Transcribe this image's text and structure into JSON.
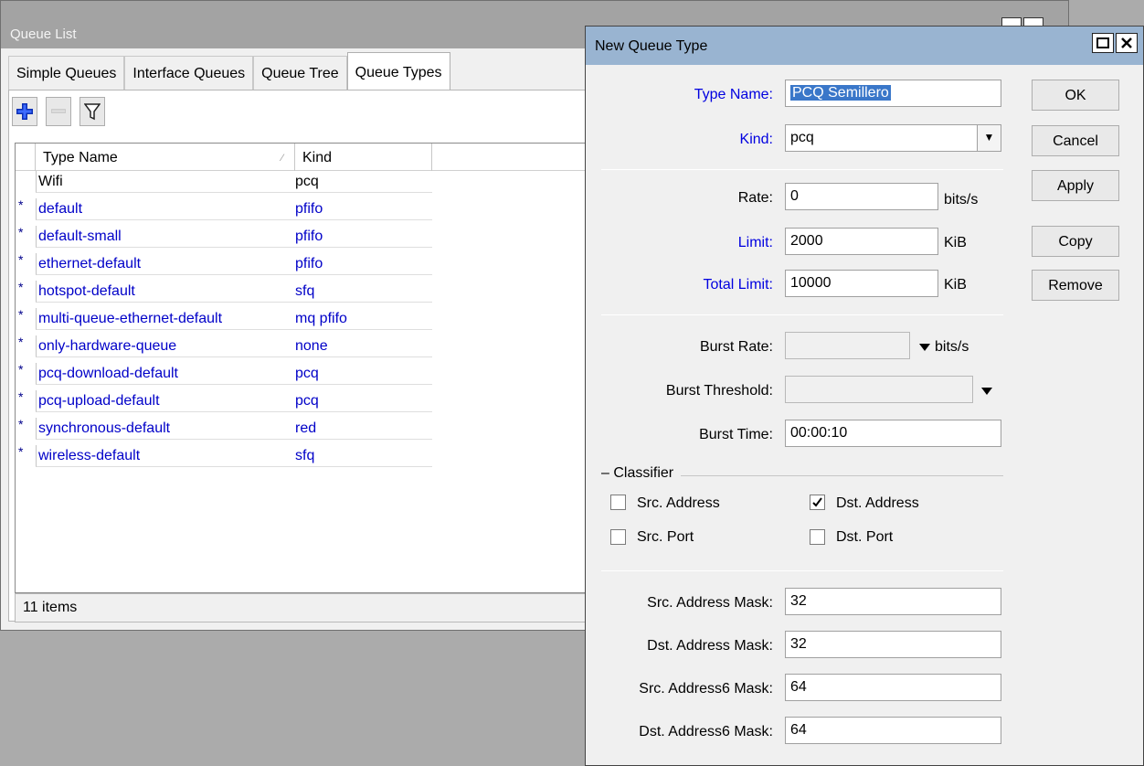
{
  "queue_list": {
    "title": "Queue List",
    "tabs": [
      "Simple Queues",
      "Interface Queues",
      "Queue Tree",
      "Queue Types"
    ],
    "active_tab": "Queue Types",
    "columns": [
      "Type Name",
      "Kind"
    ],
    "rows": [
      {
        "marker": "",
        "name": "Wifi",
        "kind": "pcq"
      },
      {
        "marker": "*",
        "name": "default",
        "kind": "pfifo"
      },
      {
        "marker": "*",
        "name": "default-small",
        "kind": "pfifo"
      },
      {
        "marker": "*",
        "name": "ethernet-default",
        "kind": "pfifo"
      },
      {
        "marker": "*",
        "name": "hotspot-default",
        "kind": "sfq"
      },
      {
        "marker": "*",
        "name": "multi-queue-ethernet-default",
        "kind": "mq pfifo"
      },
      {
        "marker": "*",
        "name": "only-hardware-queue",
        "kind": "none"
      },
      {
        "marker": "*",
        "name": "pcq-download-default",
        "kind": "pcq"
      },
      {
        "marker": "*",
        "name": "pcq-upload-default",
        "kind": "pcq"
      },
      {
        "marker": "*",
        "name": "synchronous-default",
        "kind": "red"
      },
      {
        "marker": "*",
        "name": "wireless-default",
        "kind": "sfq"
      }
    ],
    "status": "11 items"
  },
  "dialog": {
    "title": "New Queue Type",
    "labels": {
      "type_name": "Type Name:",
      "kind": "Kind:",
      "rate": "Rate:",
      "limit": "Limit:",
      "total_limit": "Total Limit:",
      "burst_rate": "Burst Rate:",
      "burst_threshold": "Burst Threshold:",
      "burst_time": "Burst Time:",
      "classifier": "Classifier",
      "src_address_mask": "Src. Address Mask:",
      "dst_address_mask": "Dst. Address Mask:",
      "src_address6_mask": "Src. Address6 Mask:",
      "dst_address6_mask": "Dst. Address6 Mask:"
    },
    "values": {
      "type_name": "PCQ Semillero",
      "kind": "pcq",
      "rate": "0",
      "limit": "2000",
      "total_limit": "10000",
      "burst_rate": "",
      "burst_threshold": "",
      "burst_time": "00:00:10",
      "src_address_mask": "32",
      "dst_address_mask": "32",
      "src_address6_mask": "64",
      "dst_address6_mask": "64"
    },
    "units": {
      "rate": "bits/s",
      "limit": "KiB",
      "total_limit": "KiB",
      "burst_rate": "bits/s"
    },
    "classifier": {
      "src_address": {
        "label": "Src. Address",
        "checked": false
      },
      "dst_address": {
        "label": "Dst. Address",
        "checked": true
      },
      "src_port": {
        "label": "Src. Port",
        "checked": false
      },
      "dst_port": {
        "label": "Dst. Port",
        "checked": false
      }
    },
    "buttons": {
      "ok": "OK",
      "cancel": "Cancel",
      "apply": "Apply",
      "copy": "Copy",
      "remove": "Remove"
    }
  },
  "colors": {
    "dialog_titlebar": "#99b4d1",
    "blue_label": "#0000e0",
    "dynamic_row": "#0000c8",
    "selection": "#3a77c9"
  }
}
